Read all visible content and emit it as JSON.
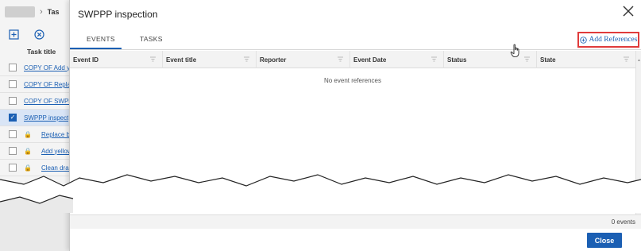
{
  "background": {
    "breadcrumb_current": "Tas",
    "column_header": "Task title",
    "rows": [
      {
        "label": "COPY OF Add y",
        "checked": false,
        "locked": false
      },
      {
        "label": "COPY OF Replac",
        "checked": false,
        "locked": false
      },
      {
        "label": "COPY OF SWPP",
        "checked": false,
        "locked": false
      },
      {
        "label": "SWPPP inspect",
        "checked": true,
        "locked": false
      },
      {
        "label": "Replace brok",
        "checked": false,
        "locked": true
      },
      {
        "label": "Add yellow r",
        "checked": false,
        "locked": true
      },
      {
        "label": "Clean drain i",
        "checked": false,
        "locked": true
      }
    ]
  },
  "dialog": {
    "title": "SWPPP inspection",
    "tabs": [
      {
        "label": "EVENTS",
        "active": true
      },
      {
        "label": "TASKS",
        "active": false
      }
    ],
    "add_references_label": "Add References",
    "columns": [
      "Event ID",
      "Event title",
      "Reporter",
      "Event Date",
      "Status",
      "State"
    ],
    "empty_message": "No event references",
    "event_count": "0 events",
    "close_label": "Close"
  },
  "colors": {
    "accent": "#1b5fb3",
    "highlight_border": "#e03b3b"
  }
}
